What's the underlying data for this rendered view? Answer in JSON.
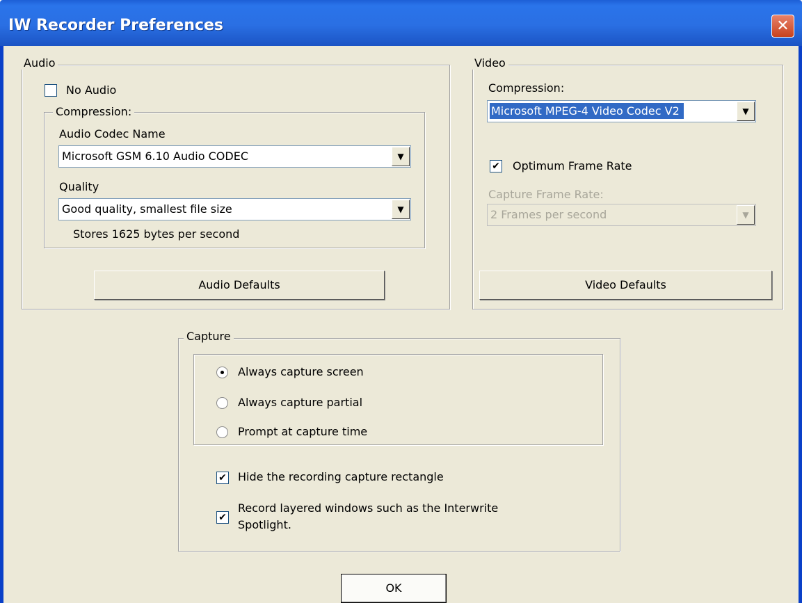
{
  "window": {
    "title": "IW Recorder Preferences",
    "close_glyph": "✕"
  },
  "audio": {
    "group_label": "Audio",
    "no_audio_label": "No Audio",
    "no_audio_checked": false,
    "compression_label": "Compression:",
    "codec_name_label": "Audio Codec Name",
    "codec_value": "Microsoft GSM 6.10 Audio CODEC",
    "quality_label": "Quality",
    "quality_value": "Good quality, smallest file size",
    "bytes_info": "Stores 1625 bytes per second",
    "defaults_button": "Audio Defaults"
  },
  "video": {
    "group_label": "Video",
    "compression_label": "Compression:",
    "codec_value": "Microsoft MPEG-4 Video Codec V2",
    "optimum_label": "Optimum Frame Rate",
    "optimum_checked": true,
    "capture_rate_label": "Capture Frame Rate:",
    "capture_rate_value": "2 Frames per second",
    "defaults_button": "Video Defaults"
  },
  "capture": {
    "group_label": "Capture",
    "options": [
      {
        "label": "Always capture screen",
        "selected": true
      },
      {
        "label": "Always capture partial",
        "selected": false
      },
      {
        "label": "Prompt at capture time",
        "selected": false
      }
    ],
    "hide_rect_label": "Hide the recording capture rectangle",
    "hide_rect_checked": true,
    "layered_label_line1": "Record layered windows such as the Interwrite",
    "layered_label_line2": "Spotlight.",
    "layered_checked": true
  },
  "ok_button": "OK",
  "icons": {
    "check": "✔",
    "arrow": "▼"
  },
  "colors": {
    "titlebar": "#2a6fe3",
    "close": "#c8421d",
    "dialog_bg": "#ece9d8",
    "selection": "#316ac5"
  }
}
